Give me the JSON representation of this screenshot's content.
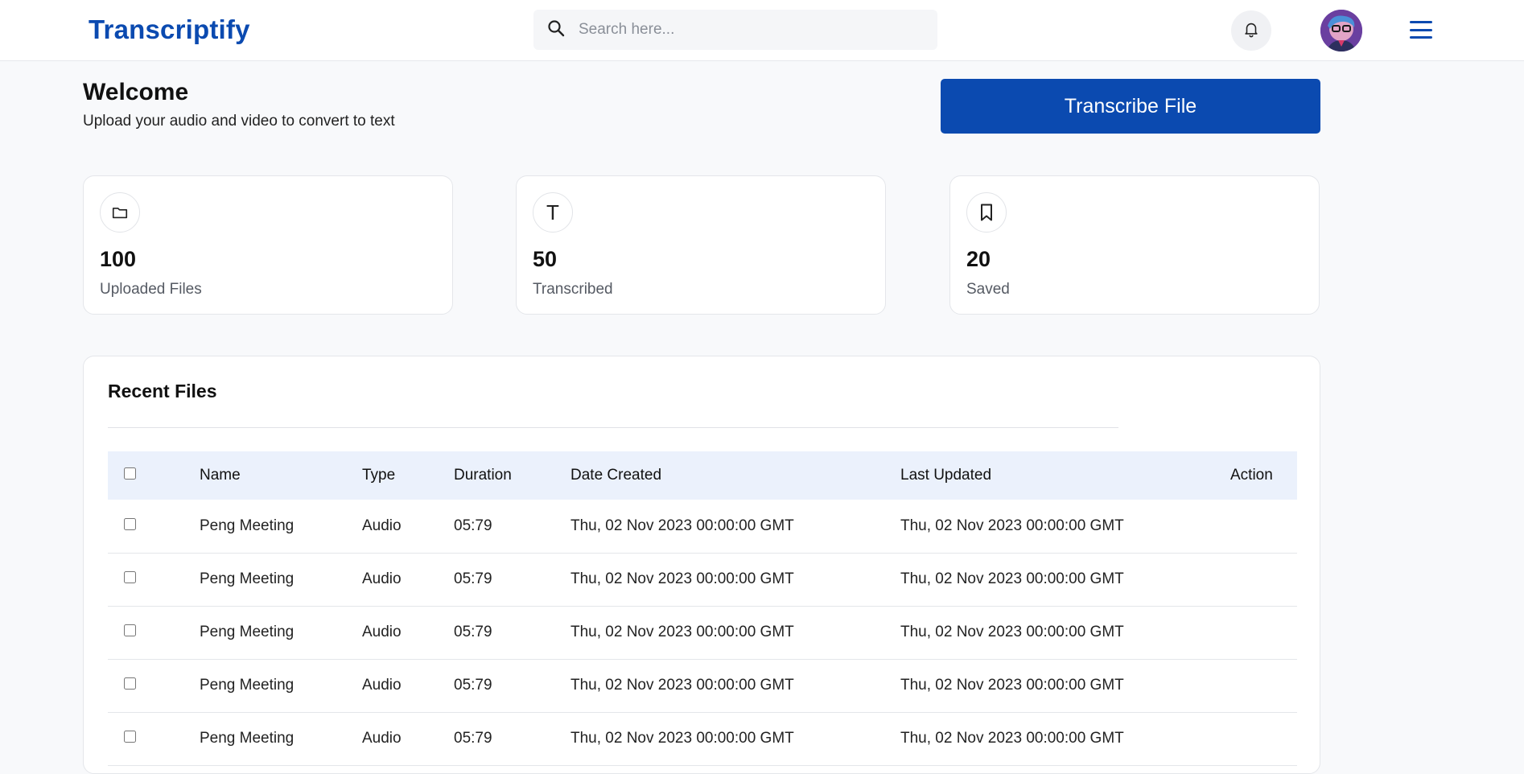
{
  "app": {
    "brand": "Transcriptify"
  },
  "header": {
    "search_placeholder": "Search here...",
    "icons": {
      "search": "search-icon",
      "notifications": "bell-icon",
      "menu": "hamburger-menu-icon"
    }
  },
  "welcome": {
    "title": "Welcome",
    "subtitle": "Upload your audio and video to convert to text",
    "button_label": "Transcribe File"
  },
  "stats": [
    {
      "icon": "folder-icon",
      "value": "100",
      "label": "Uploaded Files"
    },
    {
      "icon": "text-t-icon",
      "glyph": "T",
      "value": "50",
      "label": "Transcribed"
    },
    {
      "icon": "bookmark-icon",
      "value": "20",
      "label": "Saved"
    }
  ],
  "recent": {
    "title": "Recent Files",
    "columns": [
      "Name",
      "Type",
      "Duration",
      "Date Created",
      "Last Updated",
      "Action"
    ],
    "rows": [
      {
        "name": "Peng Meeting",
        "type": "Audio",
        "duration": "05:79",
        "date_created": "Thu, 02 Nov 2023 00:00:00 GMT",
        "last_updated": "Thu, 02 Nov 2023 00:00:00 GMT"
      },
      {
        "name": "Peng Meeting",
        "type": "Audio",
        "duration": "05:79",
        "date_created": "Thu, 02 Nov 2023 00:00:00 GMT",
        "last_updated": "Thu, 02 Nov 2023 00:00:00 GMT"
      },
      {
        "name": "Peng Meeting",
        "type": "Audio",
        "duration": "05:79",
        "date_created": "Thu, 02 Nov 2023 00:00:00 GMT",
        "last_updated": "Thu, 02 Nov 2023 00:00:00 GMT"
      },
      {
        "name": "Peng Meeting",
        "type": "Audio",
        "duration": "05:79",
        "date_created": "Thu, 02 Nov 2023 00:00:00 GMT",
        "last_updated": "Thu, 02 Nov 2023 00:00:00 GMT"
      },
      {
        "name": "Peng Meeting",
        "type": "Audio",
        "duration": "05:79",
        "date_created": "Thu, 02 Nov 2023 00:00:00 GMT",
        "last_updated": "Thu, 02 Nov 2023 00:00:00 GMT"
      }
    ]
  },
  "colors": {
    "brand": "#0b4ab0",
    "page_bg": "#f8f9fb",
    "table_header_bg": "#ebf1fc"
  }
}
